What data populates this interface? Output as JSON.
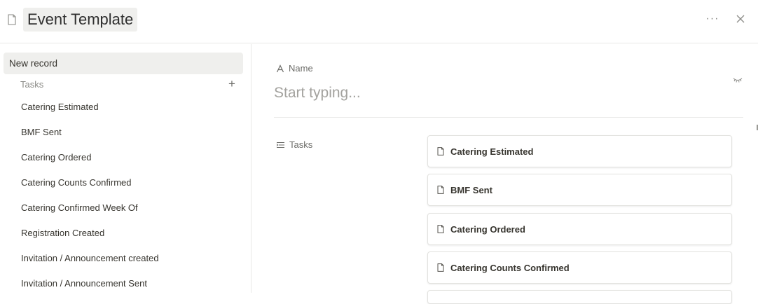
{
  "header": {
    "title": "Event Template",
    "doc_icon": "page-icon",
    "more_icon": "ellipsis-icon",
    "close_icon": "close-icon"
  },
  "sidebar": {
    "new_record_label": "New record",
    "tasks_label": "Tasks",
    "items": [
      "Catering Estimated",
      "BMF Sent",
      "Catering Ordered",
      "Catering Counts Confirmed",
      "Catering Confirmed Week Of",
      "Registration Created",
      "Invitation / Announcement created",
      "Invitation / Announcement Sent"
    ]
  },
  "main": {
    "name_label": "Name",
    "name_placeholder": "Start typing...",
    "name_value": "",
    "tasks_label": "Tasks",
    "task_cards": [
      "Catering Estimated",
      "BMF Sent",
      "Catering Ordered",
      "Catering Counts Confirmed"
    ]
  },
  "colors": {
    "highlight_bg": "#efefed",
    "text": "#37352f",
    "muted": "#8a8a86",
    "border": "#e9e9e7"
  }
}
